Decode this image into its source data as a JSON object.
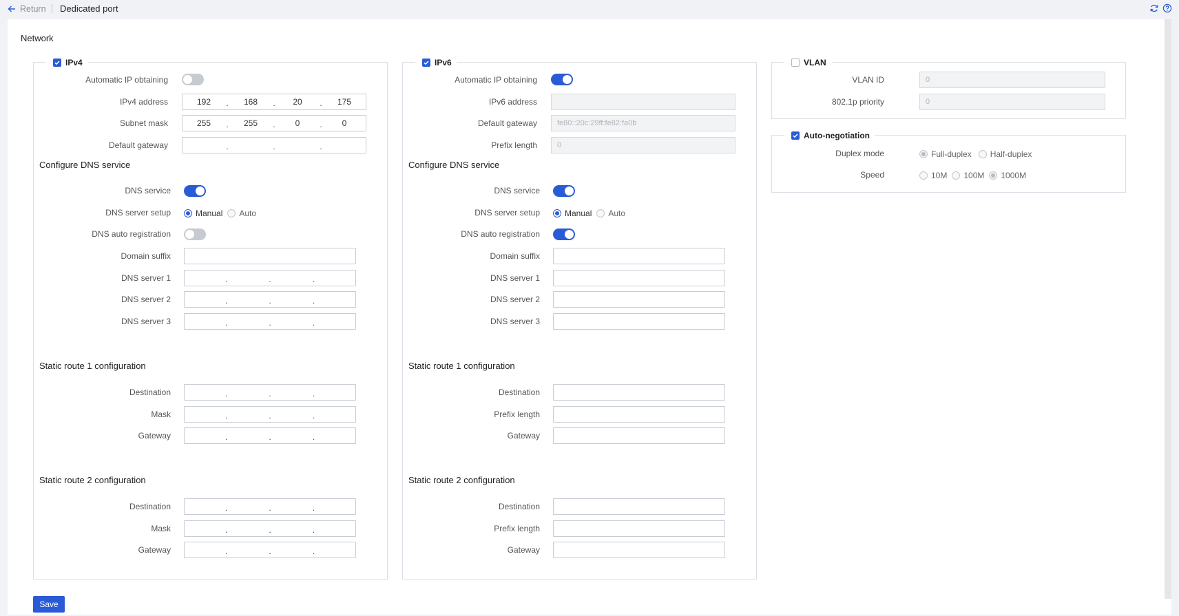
{
  "header": {
    "return_label": "Return",
    "title": "Dedicated port"
  },
  "network_title": "Network",
  "ipv4": {
    "legend": "IPv4",
    "auto_ip_label": "Automatic IP obtaining",
    "address_label": "IPv4 address",
    "address": [
      "192",
      "168",
      "20",
      "175"
    ],
    "mask_label": "Subnet mask",
    "mask": [
      "255",
      "255",
      "0",
      "0"
    ],
    "gateway_label": "Default gateway",
    "dns_section": "Configure DNS service",
    "dns_service_label": "DNS service",
    "dns_setup_label": "DNS server setup",
    "dns_manual": "Manual",
    "dns_auto": "Auto",
    "dns_auto_reg_label": "DNS auto registration",
    "domain_suffix_label": "Domain suffix",
    "dns1_label": "DNS server 1",
    "dns2_label": "DNS server 2",
    "dns3_label": "DNS server 3",
    "route1_section": "Static route 1 configuration",
    "route2_section": "Static route 2 configuration",
    "dest_label": "Destination",
    "mask_short_label": "Mask",
    "gw_label": "Gateway"
  },
  "ipv6": {
    "legend": "IPv6",
    "auto_ip_label": "Automatic IP obtaining",
    "address_label": "IPv6 address",
    "gateway_label": "Default gateway",
    "gateway_value": "fe80::20c:29ff:fe82:fa0b",
    "prefix_label": "Prefix length",
    "prefix_value": "0",
    "dns_section": "Configure DNS service",
    "dns_service_label": "DNS service",
    "dns_setup_label": "DNS server setup",
    "dns_manual": "Manual",
    "dns_auto": "Auto",
    "dns_auto_reg_label": "DNS auto registration",
    "domain_suffix_label": "Domain suffix",
    "dns1_label": "DNS server 1",
    "dns2_label": "DNS server 2",
    "dns3_label": "DNS server 3",
    "route1_section": "Static route 1 configuration",
    "route2_section": "Static route 2 configuration",
    "dest_label": "Destination",
    "prefix_short_label": "Prefix length",
    "gw_label": "Gateway"
  },
  "vlan": {
    "legend": "VLAN",
    "id_label": "VLAN ID",
    "id_value": "0",
    "priority_label": "802.1p priority",
    "priority_value": "0"
  },
  "autoneg": {
    "legend": "Auto-negotiation",
    "duplex_label": "Duplex mode",
    "full_duplex": "Full-duplex",
    "half_duplex": "Half-duplex",
    "speed_label": "Speed",
    "speed_10": "10M",
    "speed_100": "100M",
    "speed_1000": "1000M"
  },
  "save_label": "Save",
  "colors": {
    "accent": "#2a5bd7",
    "toggle_off": "#c7cad1"
  }
}
